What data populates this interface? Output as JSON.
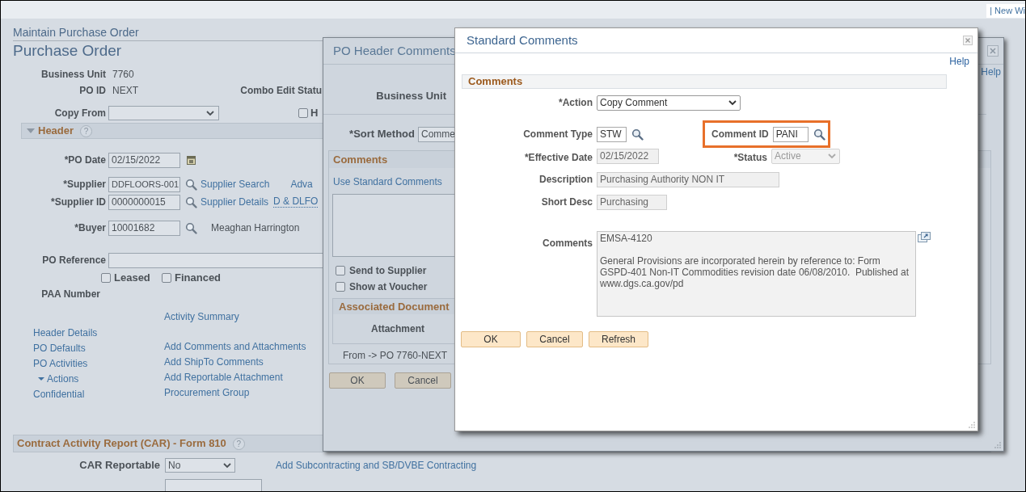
{
  "top_link": "| New Wi",
  "page": {
    "breadcrumb": "Maintain Purchase Order",
    "title": "Purchase Order",
    "business_unit": {
      "label": "Business Unit",
      "value": "7760"
    },
    "po_id": {
      "label": "PO ID",
      "value": "NEXT"
    },
    "combo_edit_status": {
      "label": "Combo Edit Statu"
    },
    "copy_from": {
      "label": "Copy From"
    },
    "hold": {
      "label": "H",
      "checked": false
    },
    "header_section": {
      "title": "Header",
      "help": "?",
      "expanded": true
    },
    "po_date": {
      "label": "*PO Date",
      "value": "02/15/2022"
    },
    "supplier": {
      "label": "*Supplier",
      "value": "DDFLOORS-001",
      "link": "Supplier Search",
      "link_2": "Adva"
    },
    "supplier_id": {
      "label": "*Supplier ID",
      "value": "0000000015",
      "link": "Supplier Details",
      "name": "D & DLFO"
    },
    "buyer": {
      "label": "*Buyer",
      "value": "10001682",
      "name": "Meaghan Harrington"
    },
    "po_reference": {
      "label": "PO Reference"
    },
    "checkboxes": [
      {
        "label": "Leased",
        "checked": false
      },
      {
        "label": "Financed",
        "checked": false
      }
    ],
    "paa_number": {
      "label": "PAA Number"
    },
    "links_left": [
      {
        "text": "Header Details",
        "kind": "link"
      },
      {
        "text": "PO Defaults",
        "kind": "link"
      },
      {
        "text": "PO Activities",
        "kind": "link"
      },
      {
        "text": "Actions",
        "kind": "menu"
      },
      {
        "text": "Confidential",
        "kind": "link"
      }
    ],
    "links_right": [
      "Activity Summary",
      "Add Comments and Attachments",
      "Add ShipTo Comments",
      "Add Reportable Attachment",
      "Procurement Group"
    ],
    "car_section": {
      "title": "Contract Activity Report (CAR) - Form 810",
      "help": "?",
      "reportable_label": "CAR Reportable",
      "reportable_value": "No",
      "link": "Add Subcontracting and SB/DVBE Contracting"
    }
  },
  "po_header_comments": {
    "title": "PO Header Comments",
    "help_link": "Help",
    "business_unit_label": "Business Unit",
    "sort_method_label": "*Sort Method",
    "sort_method_value": "Comme",
    "comments_section": {
      "title": "Comments",
      "link": "Use Standard Comments",
      "checkboxes": [
        {
          "label": "Send to Supplier",
          "checked": false
        },
        {
          "label": "Show at Voucher",
          "checked": false
        }
      ],
      "associated_document": {
        "title": "Associated Document",
        "column": "Attachment"
      },
      "from": "From -> PO 7760-NEXT"
    },
    "buttons": [
      "OK",
      "Cancel"
    ]
  },
  "standard_comments": {
    "title": "Standard Comments",
    "help_link": "Help",
    "section": "Comments",
    "action": {
      "label": "*Action",
      "value": "Copy Comment"
    },
    "comment_type": {
      "label": "Comment Type",
      "value": "STW"
    },
    "comment_id": {
      "label": "Comment ID",
      "value": "PANI",
      "highlighted": true
    },
    "effective_date": {
      "label": "*Effective Date",
      "value": "02/15/2022",
      "disabled": true
    },
    "status": {
      "label": "*Status",
      "value": "Active",
      "disabled": true
    },
    "description": {
      "label": "Description",
      "value": "Purchasing Authority NON IT",
      "disabled": true
    },
    "short_desc": {
      "label": "Short Desc",
      "value": "Purchasing",
      "disabled": true
    },
    "comments": {
      "label": "Comments",
      "value": "EMSA-4120\n\nGeneral Provisions are incorporated herein by reference to: Form GSPD-401 Non-IT Commodities revision date 06/08/2010.  Published at www.dgs.ca.gov/pd",
      "disabled": true
    },
    "buttons": [
      "OK",
      "Cancel",
      "Refresh"
    ]
  }
}
